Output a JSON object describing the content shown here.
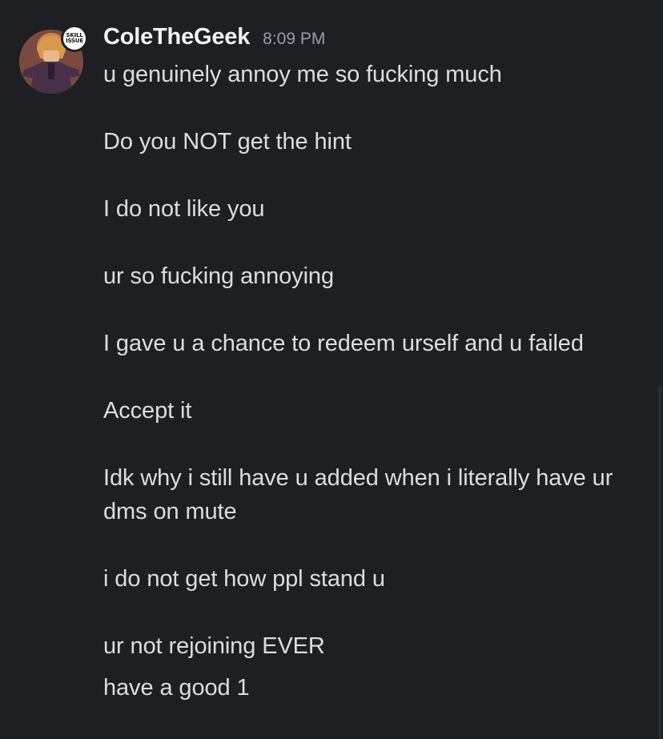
{
  "message": {
    "author": "ColeTheGeek",
    "timestamp": "8:09 PM",
    "badge": {
      "line1": "SKILL",
      "line2": "ISSUE"
    },
    "lines": [
      "u genuinely annoy me so fucking much",
      "Do you NOT get the hint",
      "I do not like you",
      "ur so fucking annoying",
      "I gave u a chance to redeem urself and u failed",
      "Accept it",
      "Idk why i still have u added when i literally have ur",
      "dms on mute",
      "i do not get how ppl stand u",
      "ur not rejoining EVER",
      "have a good 1"
    ]
  },
  "colors": {
    "background": "#1e1f22",
    "username": "#f2f3f5",
    "message_text": "#dbdee1",
    "timestamp": "#9b9ca3"
  }
}
